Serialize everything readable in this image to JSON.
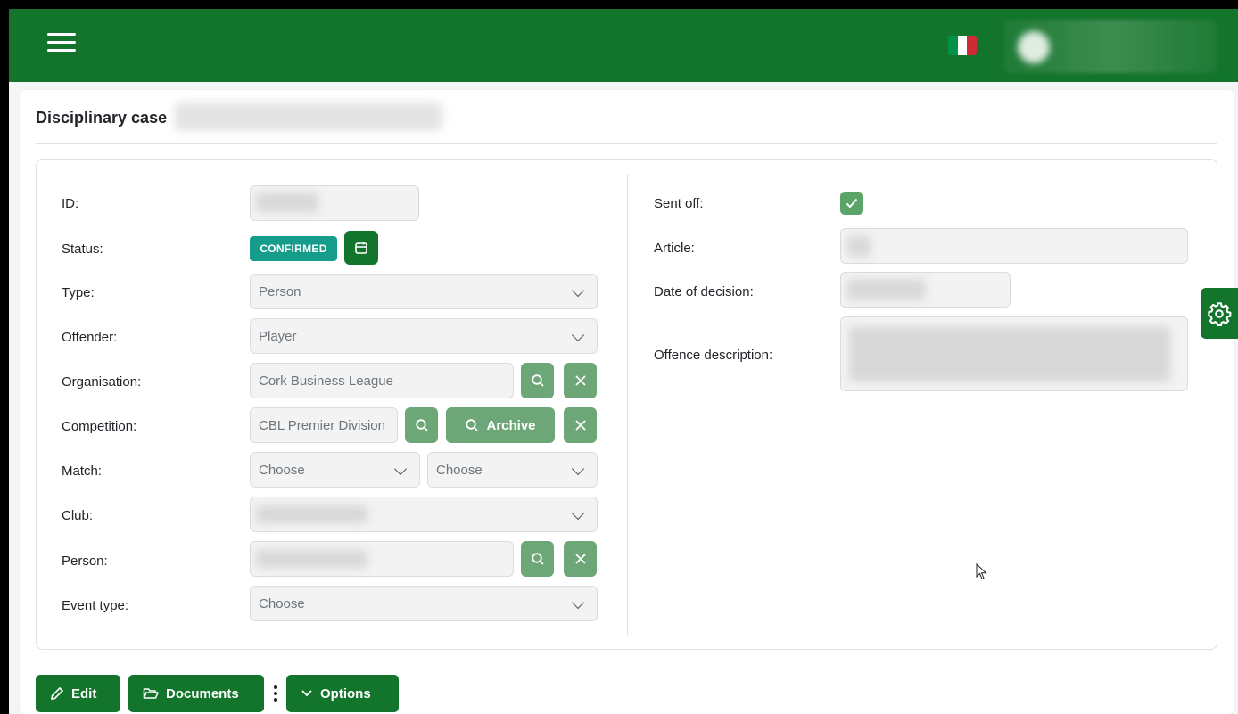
{
  "header": {
    "menu_icon": "hamburger-icon",
    "flag_colors": [
      "#009246",
      "#ffffff",
      "#ce2b37"
    ]
  },
  "page": {
    "title": "Disciplinary case"
  },
  "form_left": {
    "id": {
      "label": "ID:"
    },
    "status": {
      "label": "Status:",
      "badge": "CONFIRMED",
      "badge_color": "#159c8a"
    },
    "type": {
      "label": "Type:",
      "value": "Person"
    },
    "offender": {
      "label": "Offender:",
      "value": "Player"
    },
    "organisation": {
      "label": "Organisation:",
      "value": "Cork Business League"
    },
    "competition": {
      "label": "Competition:",
      "value": "CBL Premier Division",
      "archive_label": "Archive"
    },
    "match": {
      "label": "Match:",
      "value1": "Choose",
      "value2": "Choose"
    },
    "club": {
      "label": "Club:"
    },
    "person": {
      "label": "Person:"
    },
    "event_type": {
      "label": "Event type:",
      "value": "Choose"
    }
  },
  "form_right": {
    "sent_off": {
      "label": "Sent off:",
      "checked": true
    },
    "article": {
      "label": "Article:"
    },
    "date_of_decision": {
      "label": "Date of decision:"
    },
    "offence_description": {
      "label": "Offence description:"
    }
  },
  "actions": {
    "edit": "Edit",
    "documents": "Documents",
    "options": "Options"
  },
  "colors": {
    "brand_green": "#13742b",
    "light_green": "#6ea777",
    "teal": "#159c8a"
  }
}
